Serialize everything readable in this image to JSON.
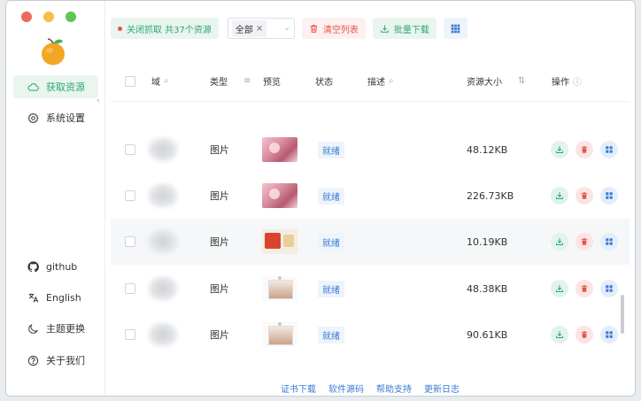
{
  "window": {
    "traffic_colors": [
      "#ec6a5e",
      "#f4bf4f",
      "#61c554"
    ]
  },
  "sidebar": {
    "items": [
      {
        "label": "获取资源",
        "icon": "cloud-icon",
        "active": true
      },
      {
        "label": "系统设置",
        "icon": "gear-icon",
        "active": false
      }
    ],
    "bottom_items": [
      {
        "label": "github",
        "icon": "github-icon"
      },
      {
        "label": "English",
        "icon": "translate-icon"
      },
      {
        "label": "主题更换",
        "icon": "moon-icon"
      },
      {
        "label": "关于我们",
        "icon": "help-circle-icon"
      }
    ]
  },
  "toolbar": {
    "status_label": "关闭抓取 共37个资源",
    "filter_tag": "全部",
    "clear_label": "清空列表",
    "download_label": "批量下载"
  },
  "table": {
    "headers": {
      "domain": "域",
      "type": "类型",
      "preview": "预览",
      "status": "状态",
      "description": "描述",
      "size": "资源大小",
      "actions": "操作"
    },
    "rows": [
      {
        "type": "图片",
        "status": "就绪",
        "size": "48.12KB",
        "thumb": "pink"
      },
      {
        "type": "图片",
        "status": "就绪",
        "size": "226.73KB",
        "thumb": "pink"
      },
      {
        "type": "图片",
        "status": "就绪",
        "size": "10.19KB",
        "thumb": "red"
      },
      {
        "type": "图片",
        "status": "就绪",
        "size": "48.38KB",
        "thumb": "card"
      },
      {
        "type": "图片",
        "status": "就绪",
        "size": "90.61KB",
        "thumb": "card"
      }
    ]
  },
  "footer": {
    "links": [
      "证书下载",
      "软件源码",
      "帮助支持",
      "更新日志"
    ]
  }
}
